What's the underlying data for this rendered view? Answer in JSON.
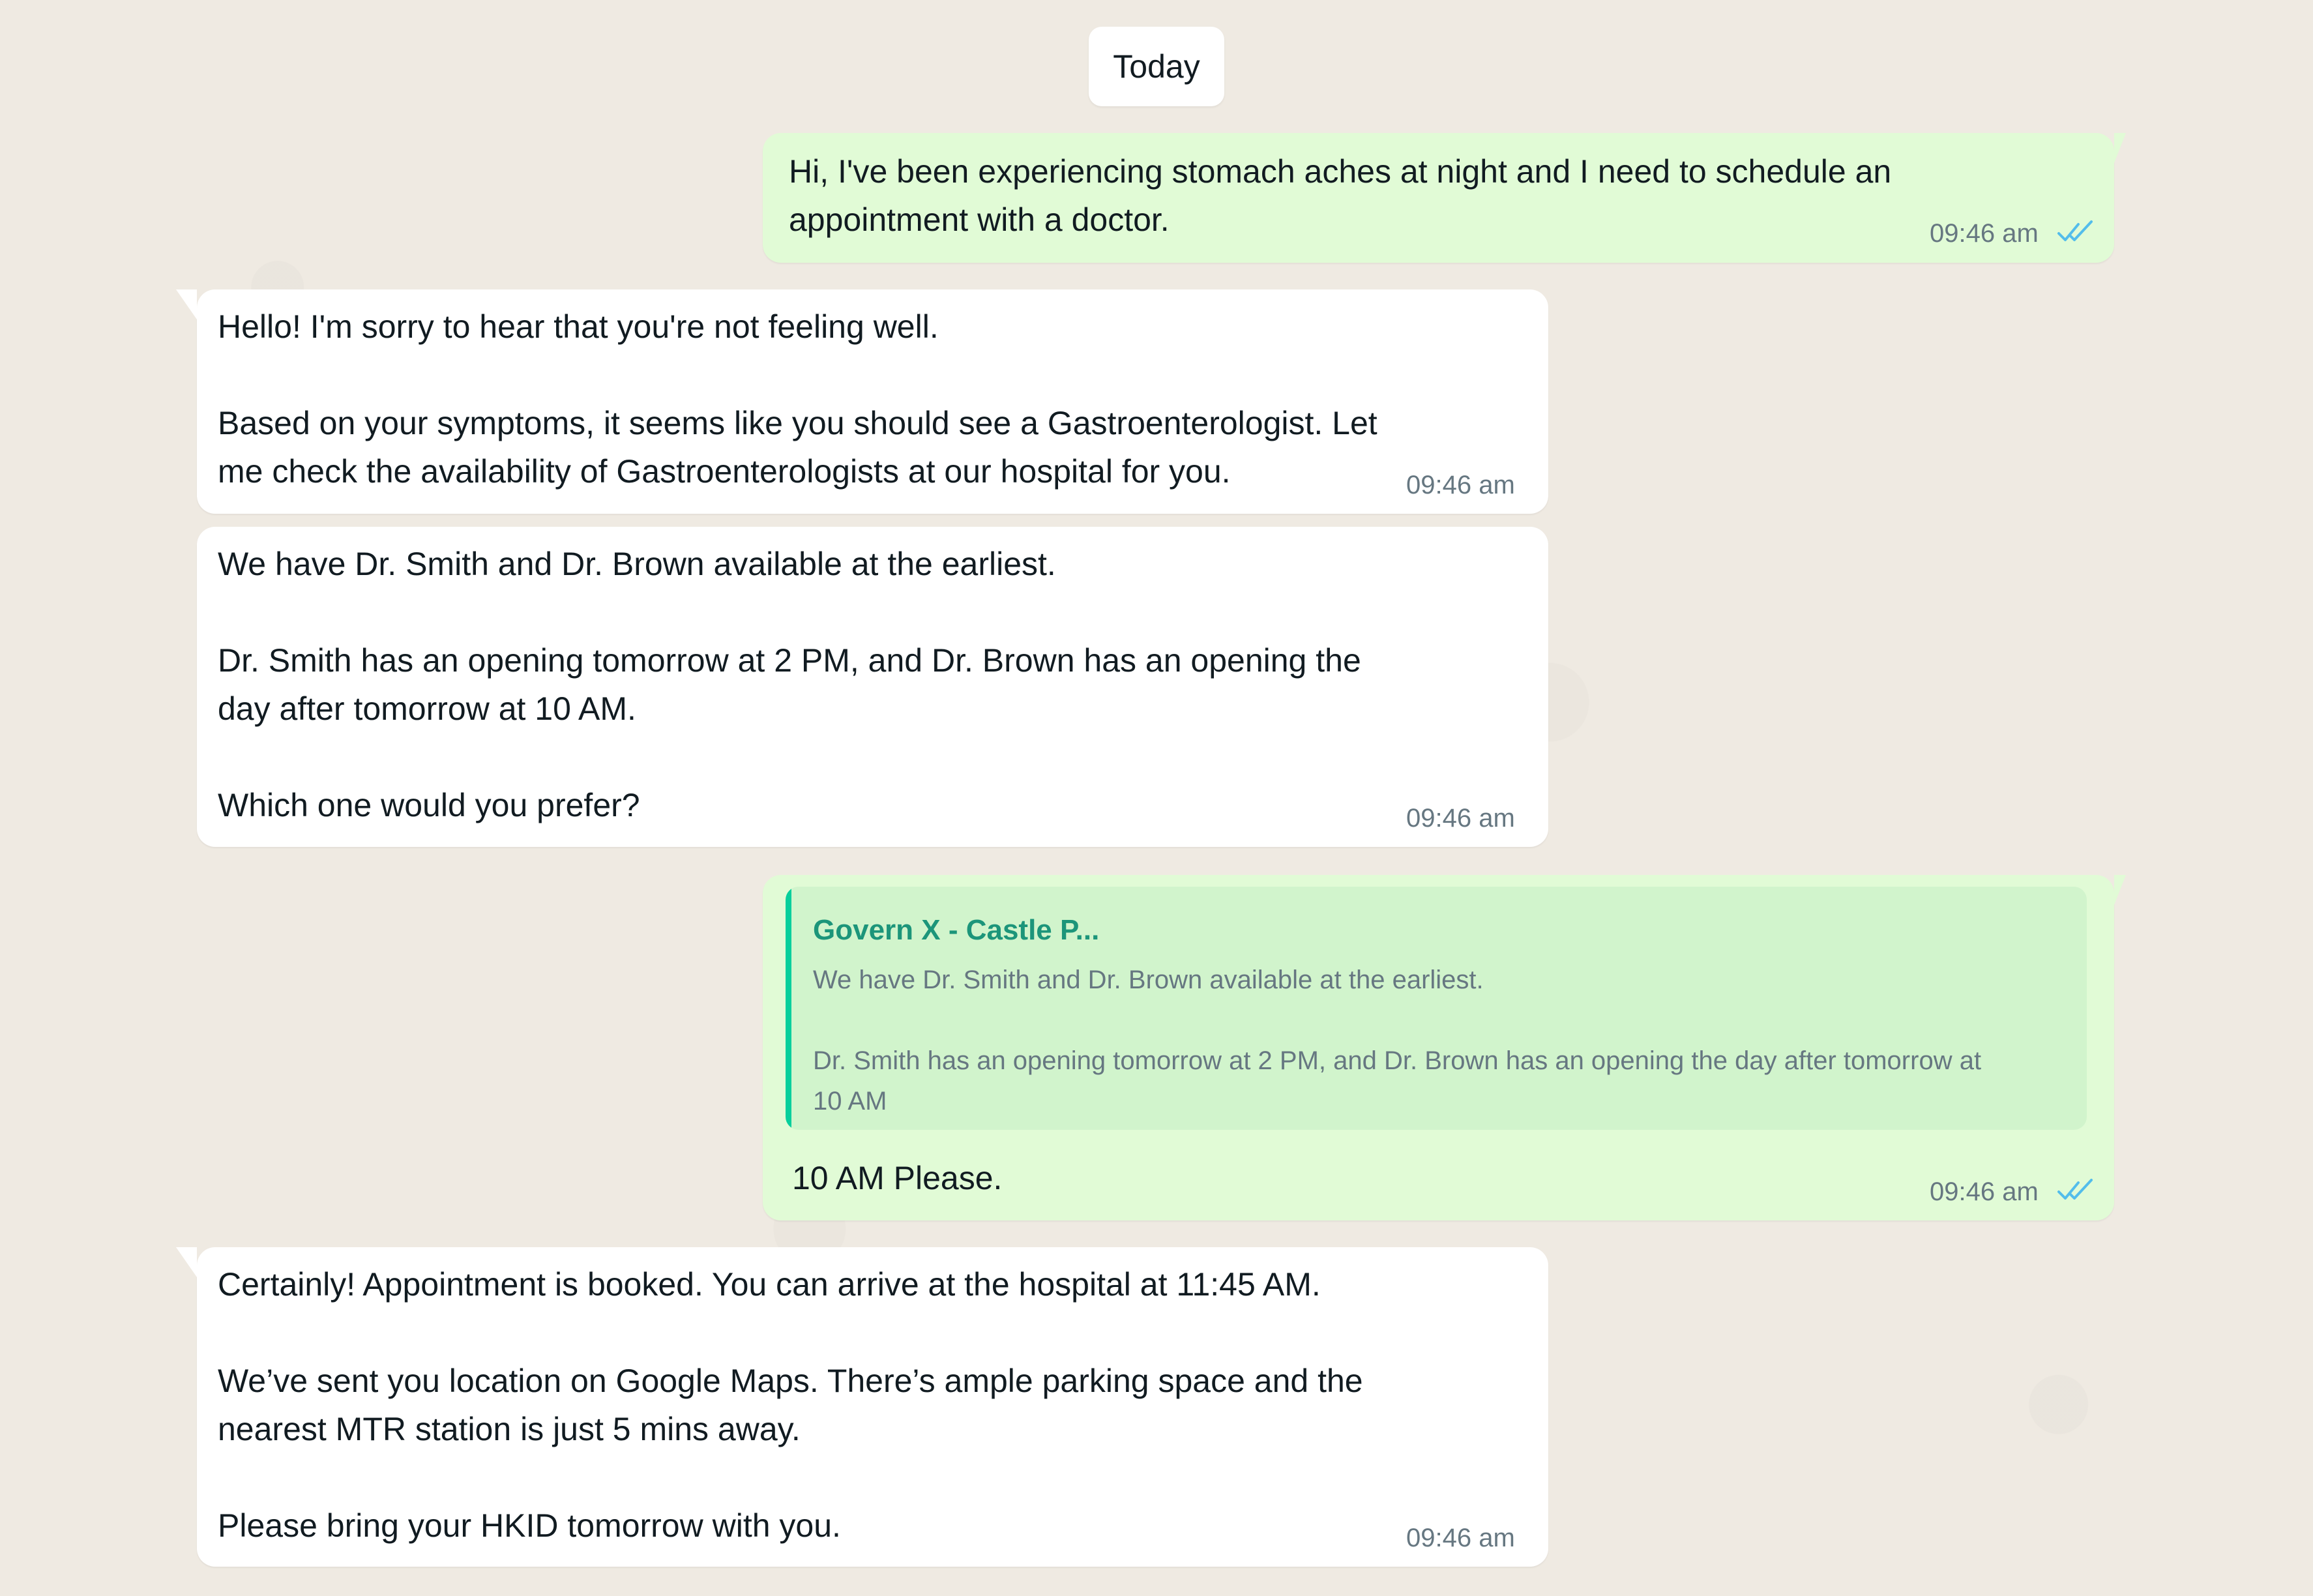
{
  "date_label": "Today",
  "messages": [
    {
      "direction": "outgoing",
      "text": "Hi, I've been experiencing stomach aches at night and I need to schedule an\nappointment with a doctor.",
      "time": "09:46 am",
      "status": "read-double-check"
    },
    {
      "direction": "incoming",
      "text": "Hello! I'm sorry to hear that you're not feeling well.\n\nBased on your symptoms, it seems like you should see a Gastroenterologist. Let\nme check the availability of Gastroenterologists at our hospital for you.",
      "time": "09:46 am"
    },
    {
      "direction": "incoming",
      "text": "We have Dr. Smith and Dr. Brown available at the earliest.\n\nDr. Smith has an opening tomorrow at 2 PM, and Dr. Brown has an opening the\nday after tomorrow at 10 AM.\n\nWhich one would you prefer?",
      "time": "09:46 am"
    },
    {
      "direction": "outgoing",
      "quote": {
        "title": "Govern X - Castle P...",
        "text": "We have Dr. Smith and Dr. Brown available at the earliest.\n\nDr. Smith has an opening tomorrow at 2 PM, and Dr. Brown has an opening the day after tomorrow at\n10 AM"
      },
      "text": "10 AM Please.",
      "time": "09:46 am",
      "status": "read-double-check"
    },
    {
      "direction": "incoming",
      "text": "Certainly! Appointment is booked. You can arrive at the hospital at 11:45 AM.\n\nWe’ve sent you location on Google Maps. There’s ample parking space and the\nnearest MTR station is just 5 mins away.\n\nPlease bring your HKID tomorrow with you.",
      "time": "09:46 am"
    }
  ],
  "colors": {
    "background": "#efeae2",
    "outgoing_bubble": "#e1fbd6",
    "incoming_bubble": "#ffffff",
    "quote_background": "#d1f4cc",
    "quote_accent": "#06cf9c",
    "quote_title": "#1c957a",
    "timestamp": "#667781",
    "read_ticks": "#53bdeb"
  }
}
